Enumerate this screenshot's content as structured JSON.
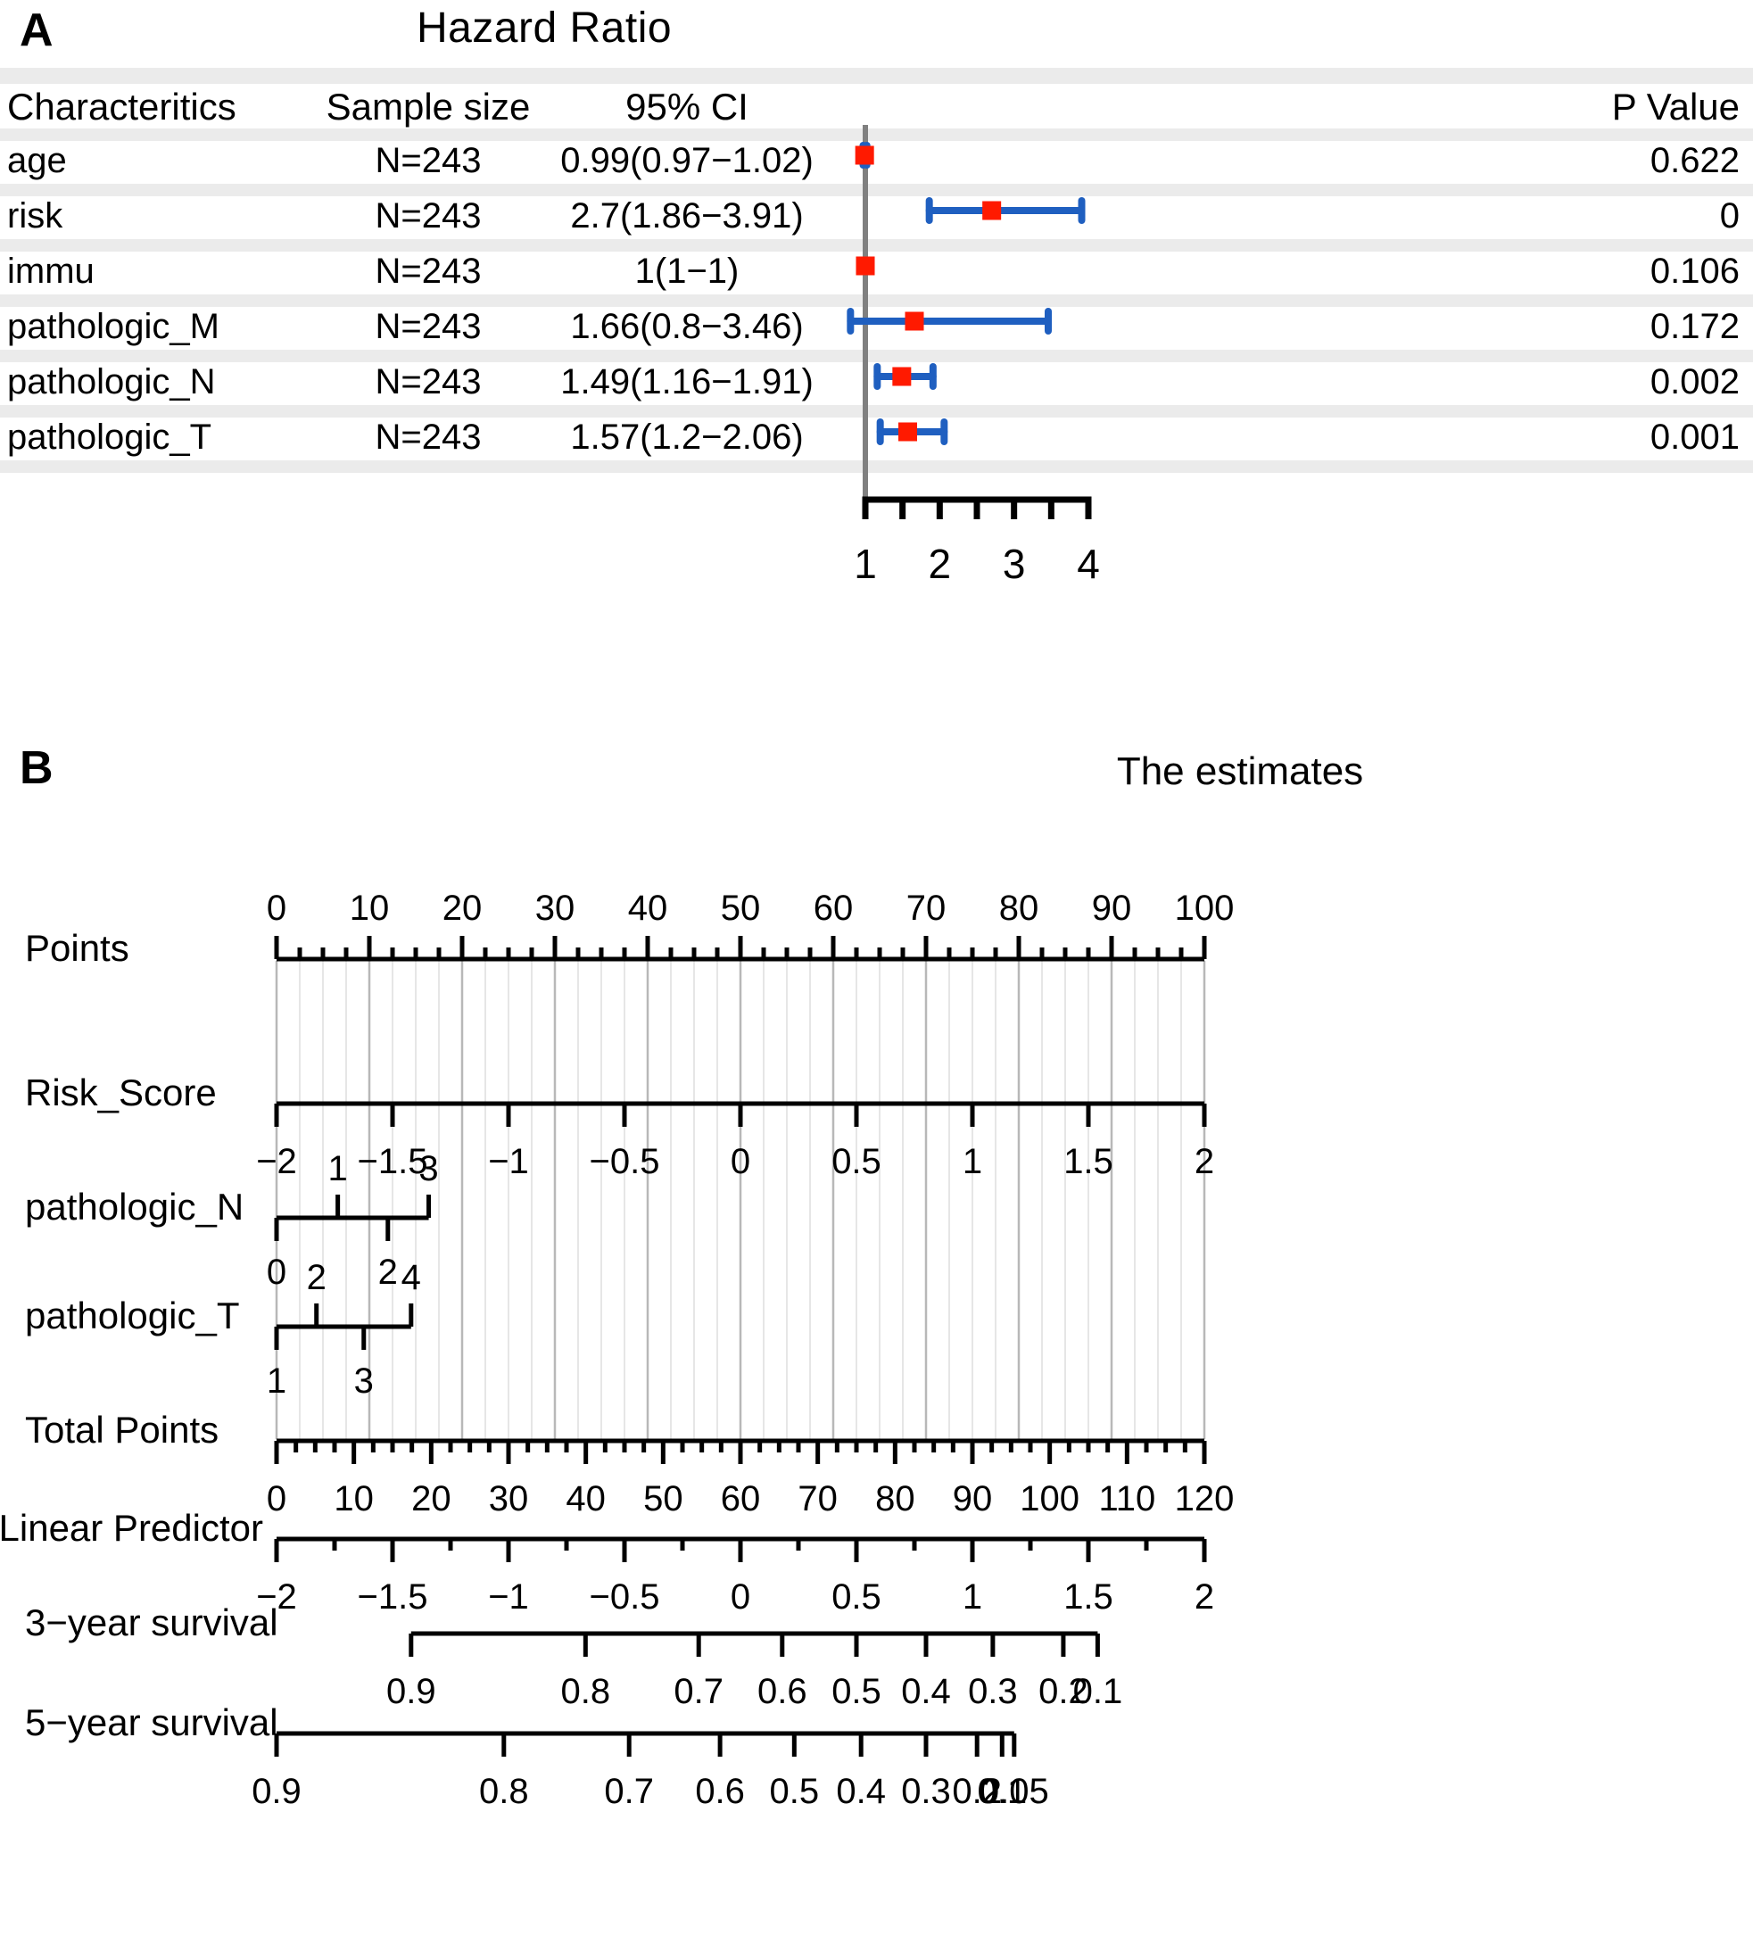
{
  "figure": {
    "panel_a_letter": "A",
    "panel_b_letter": "B",
    "title": "Hazard Ratio"
  },
  "forest_plot": {
    "headers": {
      "characteristics": "Characteritics",
      "sample_size": "Sample size",
      "ci": "95% CI",
      "p_value": "P Value"
    },
    "axis_caption": "The estimates",
    "axis": {
      "tick_values": [
        1,
        1.5,
        2,
        2.5,
        3,
        3.5,
        4
      ],
      "labeled_ticks": [
        "1",
        "",
        "2",
        "",
        "3",
        "",
        "4"
      ],
      "xmin": 1,
      "xmax": 4,
      "reference_line": 1
    },
    "colors": {
      "marker": "#ff1a00",
      "whisker": "#1f5fc0",
      "reference": "#808080",
      "stripe": "#ebebeb"
    },
    "rows": [
      {
        "characteristic": "age",
        "sample_size": "N=243",
        "ci": "0.99(0.97−1.02)",
        "p_value": "0.622",
        "estimate": 0.99,
        "lower": 0.97,
        "upper": 1.02
      },
      {
        "characteristic": "risk",
        "sample_size": "N=243",
        "ci": "2.7(1.86−3.91)",
        "p_value": "0",
        "estimate": 2.7,
        "lower": 1.86,
        "upper": 3.91
      },
      {
        "characteristic": "immu",
        "sample_size": "N=243",
        "ci": "1(1−1)",
        "p_value": "0.106",
        "estimate": 1,
        "lower": 1,
        "upper": 1
      },
      {
        "characteristic": "pathologic_M",
        "sample_size": "N=243",
        "ci": "1.66(0.8−3.46)",
        "p_value": "0.172",
        "estimate": 1.66,
        "lower": 0.8,
        "upper": 3.46
      },
      {
        "characteristic": "pathologic_N",
        "sample_size": "N=243",
        "ci": "1.49(1.16−1.91)",
        "p_value": "0.002",
        "estimate": 1.49,
        "lower": 1.16,
        "upper": 1.91
      },
      {
        "characteristic": "pathologic_T",
        "sample_size": "N=243",
        "ci": "1.57(1.2−2.06)",
        "p_value": "0.001",
        "estimate": 1.57,
        "lower": 1.2,
        "upper": 2.06
      }
    ]
  },
  "nomogram": {
    "rows": [
      {
        "label": "Points",
        "type": "scale",
        "min": 0,
        "max": 100,
        "major_ticks": [
          0,
          10,
          20,
          30,
          40,
          50,
          60,
          70,
          80,
          90,
          100
        ],
        "major_labels": [
          "0",
          "10",
          "20",
          "30",
          "40",
          "50",
          "60",
          "70",
          "80",
          "90",
          "100"
        ],
        "minor_step": 2.5,
        "labels_above": true
      },
      {
        "label": "Risk_Score",
        "type": "scale",
        "min": -2,
        "max": 2,
        "major_ticks": [
          -2,
          -1.5,
          -1,
          -0.5,
          0,
          0.5,
          1,
          1.5,
          2
        ],
        "major_labels": [
          "−2",
          "−1.5",
          "−1",
          "−0.5",
          "0",
          "0.5",
          "1",
          "1.5",
          "2"
        ],
        "minor_step": 0,
        "labels_above": false
      },
      {
        "label": "pathologic_N",
        "type": "categorical",
        "points_min": 0,
        "points_max": 16.4,
        "categories": [
          {
            "value": "0",
            "points": 0,
            "side": "below"
          },
          {
            "value": "1",
            "points": 6.6,
            "side": "above"
          },
          {
            "value": "2",
            "points": 12.0,
            "side": "below"
          },
          {
            "value": "3",
            "points": 16.4,
            "side": "above"
          }
        ]
      },
      {
        "label": "pathologic_T",
        "type": "categorical",
        "points_min": 0,
        "points_max": 14.5,
        "categories": [
          {
            "value": "1",
            "points": 0,
            "side": "below"
          },
          {
            "value": "2",
            "points": 4.3,
            "side": "above"
          },
          {
            "value": "3",
            "points": 9.4,
            "side": "below"
          },
          {
            "value": "4",
            "points": 14.5,
            "side": "above"
          }
        ]
      },
      {
        "label": "Total Points",
        "type": "scale",
        "min": 0,
        "max": 120,
        "major_ticks": [
          0,
          10,
          20,
          30,
          40,
          50,
          60,
          70,
          80,
          90,
          100,
          110,
          120
        ],
        "major_labels": [
          "0",
          "10",
          "20",
          "30",
          "40",
          "50",
          "60",
          "70",
          "80",
          "90",
          "100",
          "110",
          "120"
        ],
        "minor_step": 2.5,
        "labels_above": false
      },
      {
        "label": "Linear Predictor",
        "type": "scale",
        "min": -2,
        "max": 2,
        "major_ticks": [
          -2,
          -1.5,
          -1,
          -0.5,
          0,
          0.5,
          1,
          1.5,
          2
        ],
        "major_labels": [
          "−2",
          "−1.5",
          "−1",
          "−0.5",
          "0",
          "0.5",
          "1",
          "1.5",
          "2"
        ],
        "minor_step": 0.25,
        "labels_above": false
      },
      {
        "label": "3−year survival",
        "type": "survival",
        "span_start": 0.145,
        "span_end": 0.885,
        "ticks": [
          {
            "label": "0.9",
            "pos": 0.145
          },
          {
            "label": "0.8",
            "pos": 0.333
          },
          {
            "label": "0.7",
            "pos": 0.455
          },
          {
            "label": "0.6",
            "pos": 0.545
          },
          {
            "label": "0.5",
            "pos": 0.625
          },
          {
            "label": "0.4",
            "pos": 0.7
          },
          {
            "label": "0.3",
            "pos": 0.772
          },
          {
            "label": "0.2",
            "pos": 0.848
          },
          {
            "label": "0.1",
            "pos": 0.885
          }
        ]
      },
      {
        "label": "5−year survival",
        "type": "survival",
        "span_start": 0.0,
        "span_end": 0.795,
        "ticks": [
          {
            "label": "0.9",
            "pos": 0.0
          },
          {
            "label": "0.8",
            "pos": 0.245
          },
          {
            "label": "0.7",
            "pos": 0.38
          },
          {
            "label": "0.6",
            "pos": 0.478
          },
          {
            "label": "0.5",
            "pos": 0.558
          },
          {
            "label": "0.4",
            "pos": 0.63
          },
          {
            "label": "0.3",
            "pos": 0.7
          },
          {
            "label": "0.2",
            "pos": 0.755
          },
          {
            "label": "0.1",
            "pos": 0.782
          },
          {
            "label": "0.05",
            "pos": 0.795
          }
        ]
      }
    ]
  }
}
